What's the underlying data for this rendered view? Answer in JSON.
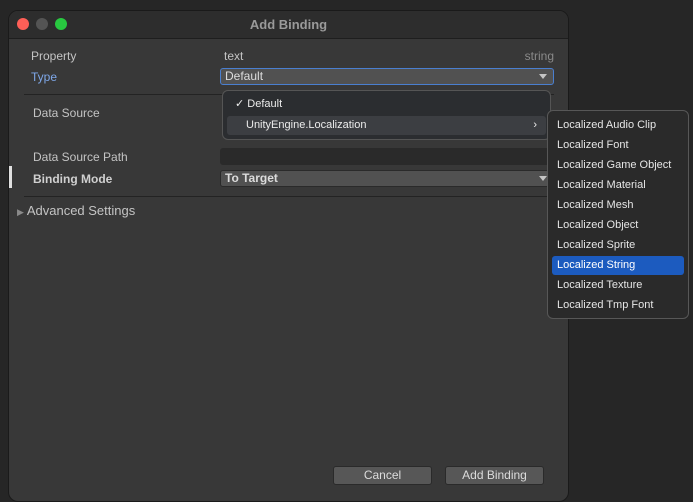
{
  "window": {
    "title": "Add Binding"
  },
  "form": {
    "property_label": "Property",
    "property_value": "text",
    "property_type": "string",
    "type_label": "Type",
    "type_value": "Default",
    "data_source_label": "Data Source",
    "data_source_path_label": "Data Source Path",
    "data_source_path_value": "",
    "binding_mode_label": "Binding Mode",
    "binding_mode_value": "To Target",
    "advanced_label": "Advanced Settings"
  },
  "type_menu": {
    "items": [
      {
        "label": "Default",
        "checked": true
      },
      {
        "label": "UnityEngine.Localization",
        "submenu": true
      }
    ]
  },
  "submenu": {
    "items": [
      "Localized Audio Clip",
      "Localized Font",
      "Localized Game Object",
      "Localized Material",
      "Localized Mesh",
      "Localized Object",
      "Localized Sprite",
      "Localized String",
      "Localized Texture",
      "Localized Tmp Font"
    ],
    "selected": "Localized String"
  },
  "buttons": {
    "cancel": "Cancel",
    "add": "Add Binding"
  },
  "colors": {
    "accent": "#1c5bbf",
    "type_label": "#7ea7e8"
  }
}
